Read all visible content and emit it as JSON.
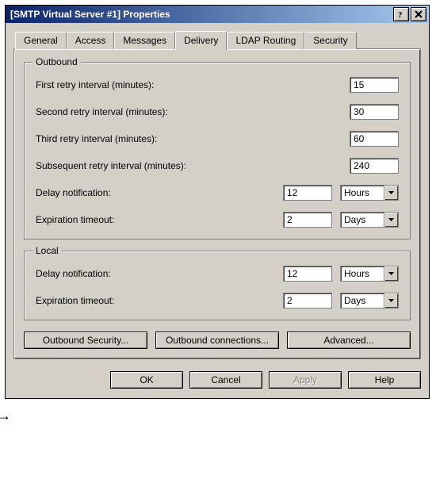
{
  "window": {
    "title": "[SMTP Virtual Server #1] Properties"
  },
  "tabs": {
    "general": "General",
    "access": "Access",
    "messages": "Messages",
    "delivery": "Delivery",
    "ldap": "LDAP Routing",
    "security": "Security"
  },
  "outbound": {
    "legend": "Outbound",
    "first_retry_label": "First retry interval (minutes):",
    "first_retry_value": "15",
    "second_retry_label": "Second retry interval (minutes):",
    "second_retry_value": "30",
    "third_retry_label": "Third retry interval (minutes):",
    "third_retry_value": "60",
    "subsequent_retry_label": "Subsequent retry interval (minutes):",
    "subsequent_retry_value": "240",
    "delay_label": "Delay notification:",
    "delay_value": "12",
    "delay_unit": "Hours",
    "expire_label": "Expiration timeout:",
    "expire_value": "2",
    "expire_unit": "Days"
  },
  "local": {
    "legend": "Local",
    "delay_label": "Delay notification:",
    "delay_value": "12",
    "delay_unit": "Hours",
    "expire_label": "Expiration timeout:",
    "expire_value": "2",
    "expire_unit": "Days"
  },
  "action_buttons": {
    "outbound_security": "Outbound Security...",
    "outbound_connections": "Outbound connections...",
    "advanced": "Advanced..."
  },
  "dialog_buttons": {
    "ok": "OK",
    "cancel": "Cancel",
    "apply": "Apply",
    "help": "Help"
  }
}
